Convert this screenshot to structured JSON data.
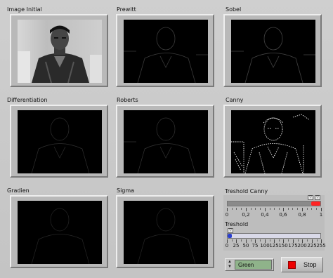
{
  "panels": [
    {
      "id": "image-initial",
      "label": "Image Initial"
    },
    {
      "id": "prewitt",
      "label": "Prewitt"
    },
    {
      "id": "sobel",
      "label": "Sobel"
    },
    {
      "id": "differentiation",
      "label": "Differentiation"
    },
    {
      "id": "roberts",
      "label": "Roberts"
    },
    {
      "id": "canny",
      "label": "Canny"
    },
    {
      "id": "gradien",
      "label": "Gradien"
    },
    {
      "id": "sigma",
      "label": "Sigma"
    }
  ],
  "canny_slider": {
    "label": "Treshold Canny",
    "ticks": [
      "0",
      "0,2",
      "0,4",
      "0,6",
      "0,8",
      "1"
    ],
    "min": 0,
    "max": 1,
    "low_value": 0.95,
    "high_value": 1.0,
    "fill_color": "#ff2222"
  },
  "threshold_slider": {
    "label": "Treshold",
    "ticks": [
      "0",
      "25",
      "50",
      "75",
      "100",
      "125",
      "150",
      "175",
      "200",
      "225",
      "255"
    ],
    "min": 0,
    "max": 255,
    "value": 0,
    "fill_color": "#2a3fcf"
  },
  "color_selector": {
    "value": "Green"
  },
  "stop_button": {
    "label": "Stop",
    "icon": "stop-square-icon",
    "color": "#ee0000"
  }
}
